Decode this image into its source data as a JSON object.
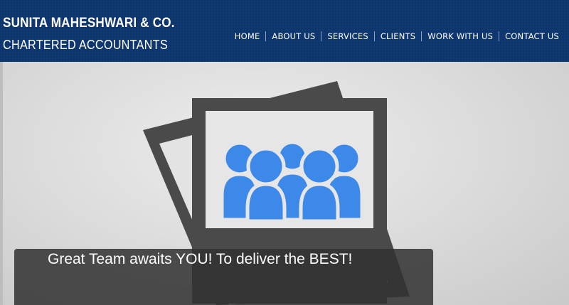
{
  "header": {
    "logo_line1": "SUNITA MAHESHWARI & CO.",
    "logo_line2": "CHARTERED ACCOUNTANTS",
    "background_color": "#0d356e"
  },
  "nav": {
    "items": [
      {
        "label": "HOME"
      },
      {
        "label": "ABOUT US"
      },
      {
        "label": "SERVICES"
      },
      {
        "label": "CLIENTS"
      },
      {
        "label": "WORK WITH US"
      },
      {
        "label": "CONTACT US"
      }
    ]
  },
  "hero": {
    "image_icon": "team-photo-icon",
    "icon_color": "#3d89ea",
    "frame_color": "#4a4a4a",
    "caption": "Great Team awaits YOU! To deliver the BEST!"
  }
}
